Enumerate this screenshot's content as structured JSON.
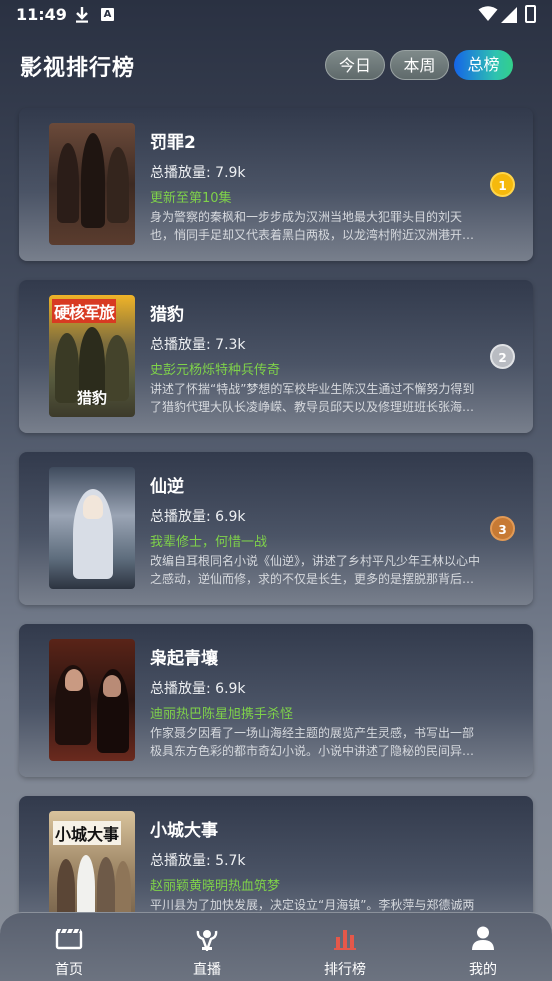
{
  "status_bar": {
    "time": "11:49",
    "a_badge": "A"
  },
  "header": {
    "title": "影视排行榜",
    "tabs": [
      {
        "label": "今日"
      },
      {
        "label": "本周"
      },
      {
        "label": "总榜"
      }
    ],
    "active_tab": "总榜"
  },
  "items": [
    {
      "title": "罚罪2",
      "plays": "总播放量: 7.9k",
      "tagline": "更新至第10集",
      "desc": "身为警察的秦枫和一步步成为汉洲当地最大犯罪头目的刘天也，悄同手足却又代表着黑白两极，以龙湾村附近汉洲港开发为背景展开。",
      "rank": "1"
    },
    {
      "title": "猎豹",
      "plays": "总播放量: 7.3k",
      "tagline": "史彭元杨烁特种兵传奇",
      "desc": "讲述了怀揣“特战”梦想的军校毕业生陈汉生通过不懈努力得到了猎豹代理大队长凌峥嵘、教导员邱天以及修理班班长张海洋的认可。",
      "rank": "2",
      "poster_text_top": "硬核军旅",
      "poster_text_bottom": "猎豹"
    },
    {
      "title": "仙逆",
      "plays": "总播放量: 6.9k",
      "tagline": "我辈修士，何惜一战",
      "desc": "改编自耳根同名小说《仙逆》，讲述了乡村平凡少年王林以心中之感动，逆仙而修，求的不仅是长生，更多的是摆脱那背后的蝼蚁之身。",
      "rank": "3"
    },
    {
      "title": "枭起青壤",
      "plays": "总播放量: 6.9k",
      "tagline": "迪丽热巴陈星旭携手杀怪",
      "desc": "作家聂夕因看了一场山海经主题的展览产生灵感，书写出一部极具东方色彩的都市奇幻小说。小说中讲述了隐秘的民间异能组织“南山猎人”的故事。"
    },
    {
      "title": "小城大事",
      "plays": "总播放量: 5.7k",
      "tagline": "赵丽颖黄晓明热血筑梦",
      "desc": "平川县为了加快发展，决定设立“月海镇”。李秋萍与郑德诚两名能力出众的干部肩负起建设新城的重任。",
      "poster_text_top": "小城大事"
    }
  ],
  "bottom_nav": [
    {
      "label": "首页",
      "icon": "film-icon"
    },
    {
      "label": "直播",
      "icon": "live-icon"
    },
    {
      "label": "排行榜",
      "icon": "rank-chart-icon"
    },
    {
      "label": "我的",
      "icon": "person-icon"
    }
  ]
}
